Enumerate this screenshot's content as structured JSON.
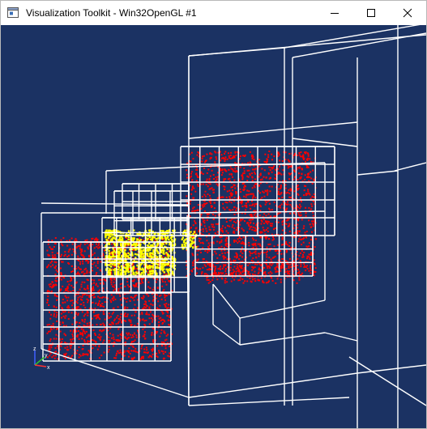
{
  "window": {
    "title": "Visualization Toolkit - Win32OpenGL #1",
    "icon": "vtk-window-icon",
    "controls": {
      "minimize": "minimize-icon",
      "maximize": "maximize-icon",
      "close": "close-icon"
    }
  },
  "viewport": {
    "background_color": "#1b3263",
    "wireframe_color": "#ffffff",
    "point_cloud_colors": [
      "#ff0000",
      "#ffff00"
    ],
    "axes": {
      "x_label": "x",
      "y_label": "y",
      "z_label": "z",
      "x_color": "#ff3030",
      "y_color": "#30c030",
      "z_color": "#4060ff"
    }
  }
}
